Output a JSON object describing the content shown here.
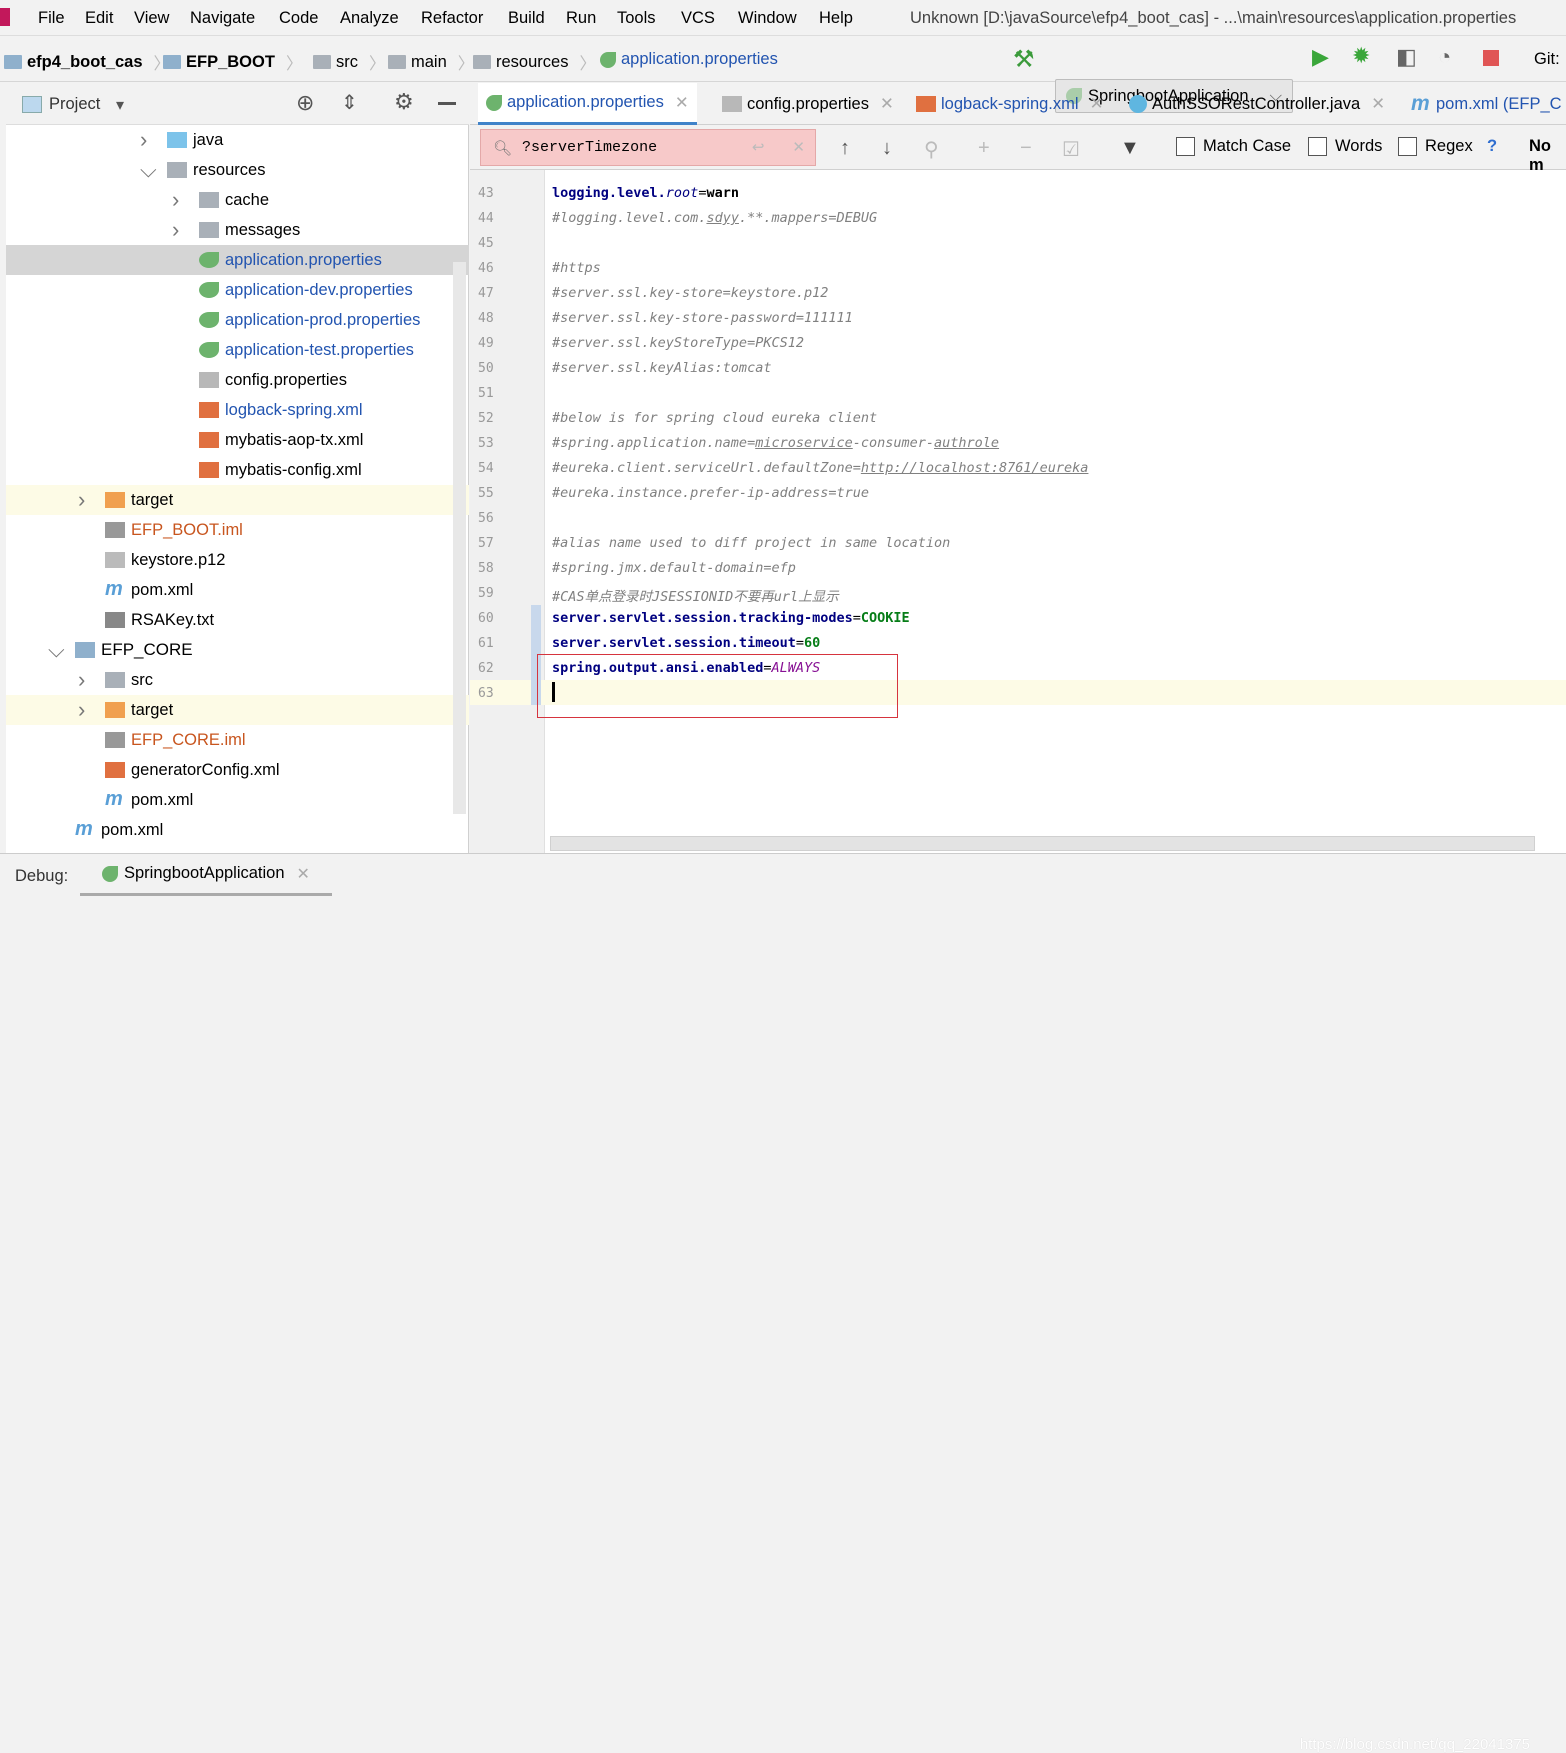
{
  "menu": [
    "File",
    "Edit",
    "View",
    "Navigate",
    "Code",
    "Analyze",
    "Refactor",
    "Build",
    "Run",
    "Tools",
    "VCS",
    "Window",
    "Help"
  ],
  "window_title": "Unknown [D:\\javaSource\\efp4_boot_cas] - ...\\main\\resources\\application.properties",
  "breadcrumbs": [
    "efp4_boot_cas",
    "EFP_BOOT",
    "src",
    "main",
    "resources",
    "application.properties"
  ],
  "run_config": "SpringbootApplication",
  "git_label": "Git:",
  "project_panel": {
    "title": "Project"
  },
  "tree": [
    {
      "label": "java",
      "type": "folder-src"
    },
    {
      "label": "resources",
      "type": "folder-res",
      "expanded": true
    },
    {
      "label": "cache",
      "type": "folder"
    },
    {
      "label": "messages",
      "type": "folder"
    },
    {
      "label": "application.properties",
      "type": "spring",
      "selected": true
    },
    {
      "label": "application-dev.properties",
      "type": "spring"
    },
    {
      "label": "application-prod.properties",
      "type": "spring"
    },
    {
      "label": "application-test.properties",
      "type": "spring"
    },
    {
      "label": "config.properties",
      "type": "props"
    },
    {
      "label": "logback-spring.xml",
      "type": "xml"
    },
    {
      "label": "mybatis-aop-tx.xml",
      "type": "xml"
    },
    {
      "label": "mybatis-config.xml",
      "type": "xml"
    },
    {
      "label": "target",
      "type": "folder-excl"
    },
    {
      "label": "EFP_BOOT.iml",
      "type": "iml"
    },
    {
      "label": "keystore.p12",
      "type": "unknown"
    },
    {
      "label": "pom.xml",
      "type": "maven"
    },
    {
      "label": "RSAKey.txt",
      "type": "text"
    },
    {
      "label": "EFP_CORE",
      "type": "module",
      "expanded": true
    },
    {
      "label": "src",
      "type": "folder"
    },
    {
      "label": "target",
      "type": "folder-excl"
    },
    {
      "label": "EFP_CORE.iml",
      "type": "iml"
    },
    {
      "label": "generatorConfig.xml",
      "type": "xml"
    },
    {
      "label": "pom.xml",
      "type": "maven"
    },
    {
      "label": "pom.xml",
      "type": "maven"
    }
  ],
  "tabs": [
    {
      "label": "application.properties",
      "active": true
    },
    {
      "label": "config.properties"
    },
    {
      "label": "logback-spring.xml"
    },
    {
      "label": "AuthSSORestController.java"
    },
    {
      "label": "pom.xml (EFP_C"
    }
  ],
  "search": {
    "value": "?serverTimezone",
    "match_case": "Match Case",
    "words": "Words",
    "regex": "Regex",
    "help": "?",
    "result": "No m"
  },
  "code": [
    {
      "n": "43",
      "segs": [
        [
          "k",
          "logging.level."
        ],
        [
          "it",
          "root"
        ],
        [
          "v",
          "="
        ],
        [
          "vb",
          "warn"
        ]
      ]
    },
    {
      "n": "44",
      "segs": [
        [
          "c",
          "#logging.level.com."
        ],
        [
          "c u",
          "sdyy"
        ],
        [
          "c",
          ".**.mappers=DEBUG"
        ]
      ]
    },
    {
      "n": "45",
      "segs": []
    },
    {
      "n": "46",
      "segs": [
        [
          "c",
          "#https"
        ]
      ]
    },
    {
      "n": "47",
      "segs": [
        [
          "c",
          "#server.ssl.key-store=keystore.p12"
        ]
      ]
    },
    {
      "n": "48",
      "segs": [
        [
          "c",
          "#server.ssl.key-store-password=111111"
        ]
      ]
    },
    {
      "n": "49",
      "segs": [
        [
          "c",
          "#server.ssl.keyStoreType=PKCS12"
        ]
      ]
    },
    {
      "n": "50",
      "segs": [
        [
          "c",
          "#server.ssl.keyAlias:tomcat"
        ]
      ]
    },
    {
      "n": "51",
      "segs": []
    },
    {
      "n": "52",
      "segs": [
        [
          "c",
          "#below is for spring cloud eureka client"
        ]
      ]
    },
    {
      "n": "53",
      "segs": [
        [
          "c",
          "#spring.application.name="
        ],
        [
          "c u",
          "microservice"
        ],
        [
          "c",
          "-consumer-"
        ],
        [
          "c u",
          "authrole"
        ]
      ]
    },
    {
      "n": "54",
      "segs": [
        [
          "c",
          "#eureka.client.serviceUrl.defaultZone="
        ],
        [
          "c u",
          "http://localhost:8761/eureka"
        ]
      ]
    },
    {
      "n": "55",
      "segs": [
        [
          "c",
          "#eureka.instance.prefer-ip-address=true"
        ]
      ]
    },
    {
      "n": "56",
      "segs": []
    },
    {
      "n": "57",
      "segs": [
        [
          "c",
          "#alias name used to diff project in same location"
        ]
      ]
    },
    {
      "n": "58",
      "segs": [
        [
          "c",
          "#spring.jmx.default-domain=efp"
        ]
      ]
    },
    {
      "n": "59",
      "segs": [
        [
          "c",
          "#CAS单点登录时JSESSIONID不要再url上显示"
        ]
      ]
    },
    {
      "n": "60",
      "segs": [
        [
          "k",
          "server.servlet.session.tracking-modes"
        ],
        [
          "v",
          "="
        ],
        [
          "vg",
          "COOKIE"
        ]
      ]
    },
    {
      "n": "61",
      "segs": [
        [
          "k",
          "server.servlet.session.timeout"
        ],
        [
          "v",
          "="
        ],
        [
          "vg",
          "60"
        ]
      ]
    },
    {
      "n": "62",
      "segs": [
        [
          "k",
          "spring.output.ansi.enabled"
        ],
        [
          "v",
          "="
        ],
        [
          "vp",
          "ALWAYS"
        ]
      ]
    },
    {
      "n": "63",
      "segs": []
    }
  ],
  "debug": {
    "label": "Debug:",
    "tab": "SpringbootApplication"
  },
  "watermark": "https://blog.csdn.net/qq_22041375",
  "colors": {
    "accent": "#4083c9",
    "search_no_match": "#f7c9c9",
    "highlight_box": "#d6343e",
    "keyword": "#000080",
    "comment": "#808080"
  }
}
